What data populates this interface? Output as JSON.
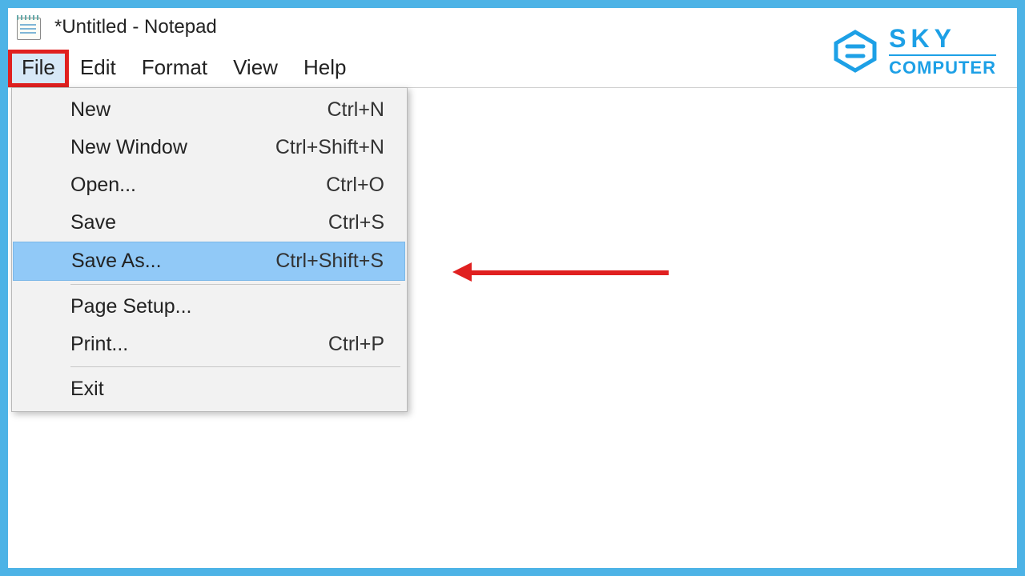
{
  "window": {
    "title": "*Untitled - Notepad"
  },
  "menubar": {
    "file": "File",
    "edit": "Edit",
    "format": "Format",
    "view": "View",
    "help": "Help"
  },
  "fileMenu": {
    "new": {
      "label": "New",
      "shortcut": "Ctrl+N"
    },
    "newWindow": {
      "label": "New Window",
      "shortcut": "Ctrl+Shift+N"
    },
    "open": {
      "label": "Open...",
      "shortcut": "Ctrl+O"
    },
    "save": {
      "label": "Save",
      "shortcut": "Ctrl+S"
    },
    "saveAs": {
      "label": "Save As...",
      "shortcut": "Ctrl+Shift+S"
    },
    "pageSetup": {
      "label": "Page Setup...",
      "shortcut": ""
    },
    "print": {
      "label": "Print...",
      "shortcut": "Ctrl+P"
    },
    "exit": {
      "label": "Exit",
      "shortcut": ""
    }
  },
  "logo": {
    "line1": "SKY",
    "line2": "COMPUTER"
  },
  "annotation": {
    "highlightedMenu": "File",
    "highlightedItem": "Save As...",
    "arrowPointsTo": "Save As..."
  }
}
